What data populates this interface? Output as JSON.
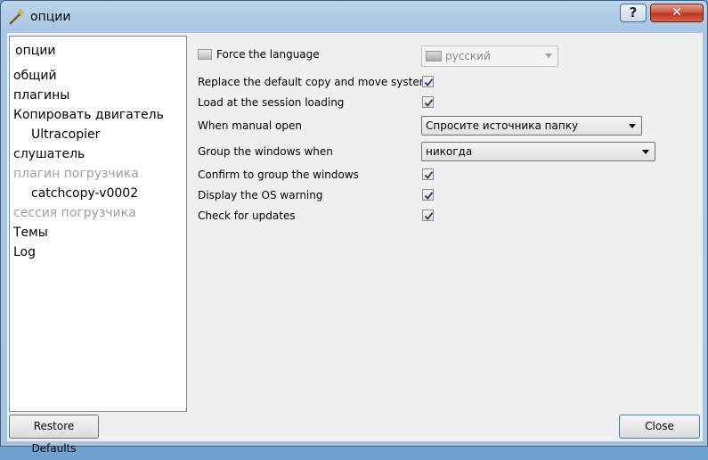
{
  "window": {
    "title": "опции",
    "help_label": "?",
    "close_label": "✕"
  },
  "sidebar": {
    "header": "опции",
    "items": [
      {
        "label": "общий",
        "disabled": false
      },
      {
        "label": "плагины",
        "disabled": false
      },
      {
        "label": "Копировать двигатель",
        "disabled": false
      },
      {
        "label": "Ultracopier",
        "disabled": false,
        "sub": true
      },
      {
        "label": "слушатель",
        "disabled": false
      },
      {
        "label": "плагин погрузчика",
        "disabled": true
      },
      {
        "label": "catchcopy-v0002",
        "disabled": false,
        "sub": true
      },
      {
        "label": "сессия погрузчика",
        "disabled": true
      },
      {
        "label": "Темы",
        "disabled": false
      },
      {
        "label": "Log",
        "disabled": false
      }
    ]
  },
  "settings": {
    "force_language": {
      "label": "Force the language",
      "checked": false,
      "value": "русский",
      "disabled": true
    },
    "replace_default": {
      "label": "Replace the default copy and move system",
      "checked": true
    },
    "load_session": {
      "label": "Load at the session loading",
      "checked": true
    },
    "manual_open": {
      "label": "When manual open",
      "value": "Спросите источника папку"
    },
    "group_windows": {
      "label": "Group the windows when",
      "value": "никогда"
    },
    "confirm_group": {
      "label": "Confirm to group the windows",
      "checked": true
    },
    "os_warning": {
      "label": "Display the OS warning",
      "checked": true
    },
    "check_updates": {
      "label": "Check for updates",
      "checked": true
    }
  },
  "buttons": {
    "restore_defaults": "Restore Defaults",
    "close": "Close"
  },
  "colors": {
    "accent": "#3c7fb1",
    "disabled_text": "#a0a0a0"
  }
}
